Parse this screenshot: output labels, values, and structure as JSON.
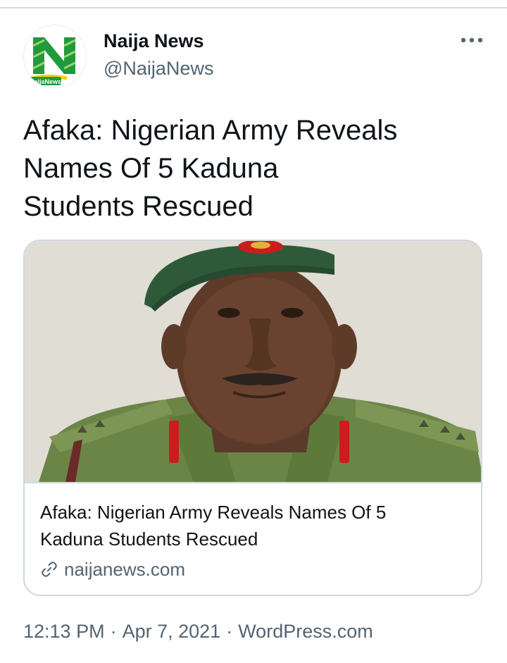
{
  "author": {
    "display_name": "Naija News",
    "handle": "@NaijaNews",
    "avatar_text": "NaijaNews",
    "avatar_icon": "naija-news-logo",
    "brand_color": "#1f9a3c"
  },
  "menu": {
    "icon": "more-horizontal-icon"
  },
  "tweet": {
    "text_line1": "Afaka: Nigerian Army Reveals",
    "text_line2": "Names Of 5 Kaduna",
    "text_line3": "Students Rescued"
  },
  "card": {
    "image_description_icon": "soldier-portrait-image",
    "title_line1": "Afaka: Nigerian Army Reveals Names Of 5",
    "title_line2": "Kaduna Students Rescued",
    "domain": "naijanews.com",
    "link_icon": "link-icon"
  },
  "meta": {
    "time": "12:13 PM",
    "separator1": "·",
    "date": "Apr 7, 2021",
    "separator2": "·",
    "source": "WordPress.com"
  },
  "colors": {
    "text_primary": "#0f1419",
    "text_secondary": "#536471",
    "border": "#cfd9de",
    "uniform_green": "#5e7a3a",
    "beret_green": "#2f5a3a"
  }
}
